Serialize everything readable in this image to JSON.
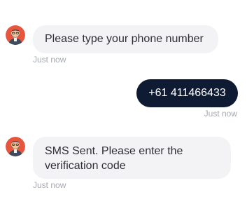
{
  "avatar_icon": "bearded-man-avatar-icon",
  "colors": {
    "bot_bubble": "#f3f3f5",
    "user_bubble": "#0f1a33",
    "timestamp": "#a7aab3",
    "avatar_background": "#e8553e"
  },
  "messages": [
    {
      "sender": "bot",
      "text": "Please type your phone number",
      "time": "Just now"
    },
    {
      "sender": "user",
      "text": "+61 411466433",
      "time": "Just now"
    },
    {
      "sender": "bot",
      "text": "SMS Sent. Please enter the verification code",
      "time": "Just now"
    }
  ]
}
